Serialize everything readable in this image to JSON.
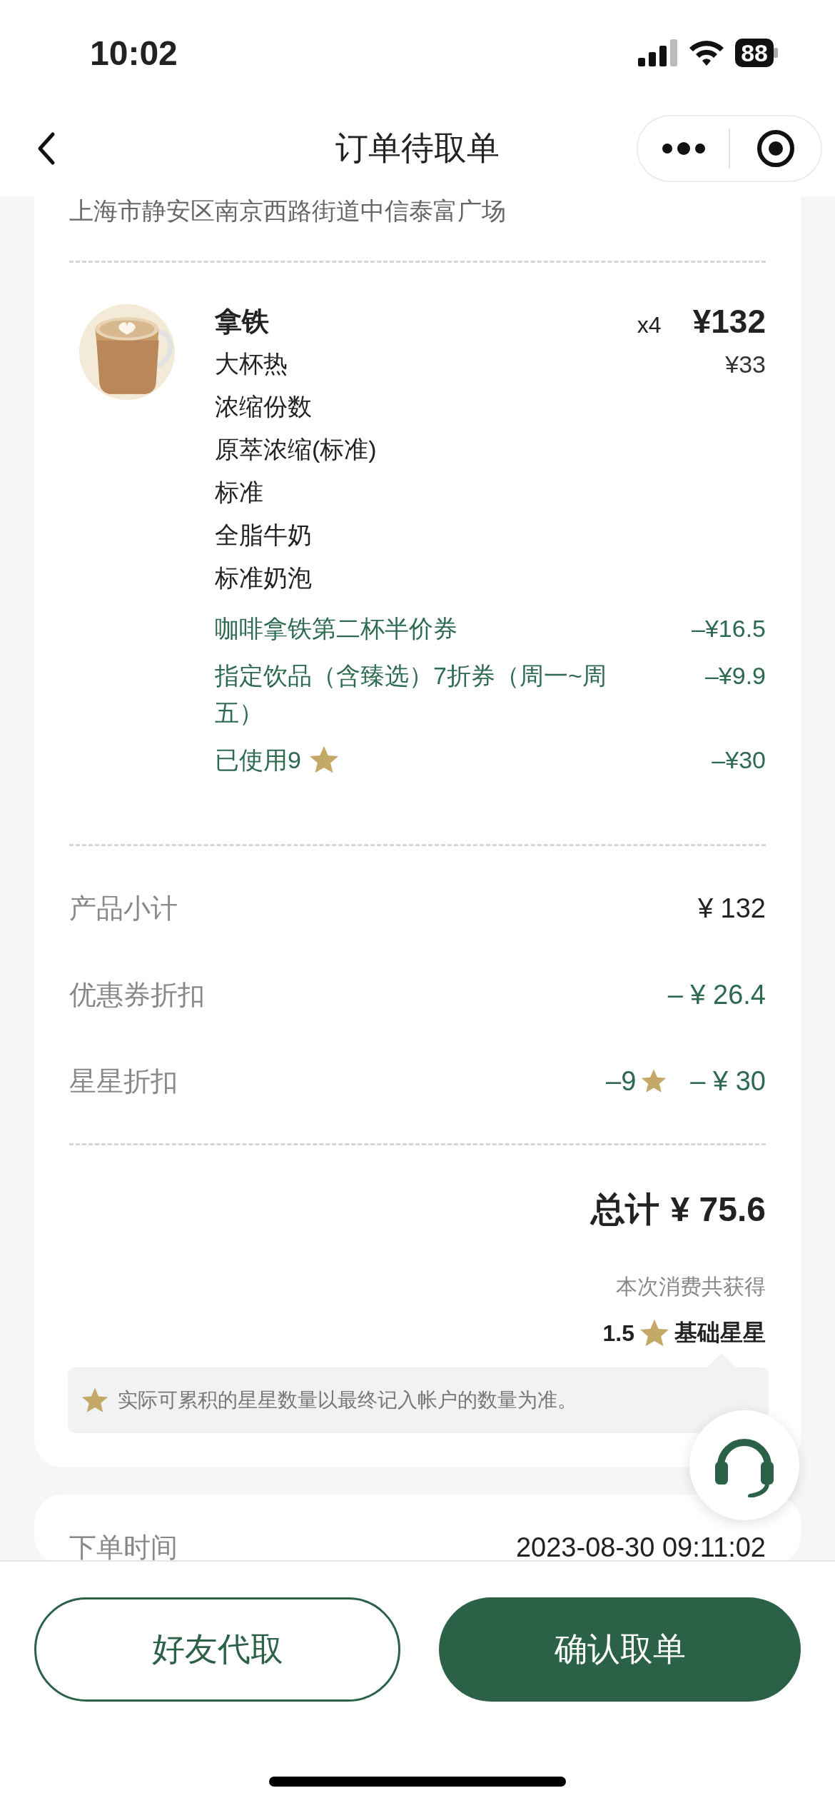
{
  "status_bar": {
    "time": "10:02",
    "battery": "88"
  },
  "nav": {
    "title": "订单待取单"
  },
  "store": {
    "address": "上海市静安区南京西路街道中信泰富广场"
  },
  "items": [
    {
      "name": "拿铁",
      "quantity": "x4",
      "price": "¥132",
      "unit_price": "¥33",
      "options": [
        "大杯热",
        "浓缩份数",
        "原萃浓缩(标准)",
        "标准",
        "全脂牛奶",
        "标准奶泡"
      ],
      "discounts": [
        {
          "kind": "coupon",
          "label": "咖啡拿铁第二杯半价券",
          "amount": "–¥16.5"
        },
        {
          "kind": "coupon",
          "label": "指定饮品（含臻选）7折券（周一~周五）",
          "amount": "–¥9.9"
        },
        {
          "kind": "stars",
          "label": "已使用9",
          "amount": "–¥30"
        }
      ]
    }
  ],
  "summary": [
    {
      "kind": "plain",
      "label": "产品小计",
      "value": "¥ 132"
    },
    {
      "kind": "discount",
      "label": "优惠券折扣",
      "value": "– ¥ 26.4"
    },
    {
      "kind": "stars",
      "label": "星星折扣",
      "stars_used": "–9",
      "value": "– ¥ 30"
    }
  ],
  "total": {
    "label": "总计",
    "amount": "¥ 75.6"
  },
  "earned": {
    "caption": "本次消费共获得",
    "count": "1.5",
    "label": "基础星星"
  },
  "note": "实际可累积的星星数量以最终记入帐户的数量为准。",
  "order_info": [
    {
      "label": "下单时间",
      "value": "2023-08-30 09:11:02"
    }
  ],
  "actions": [
    {
      "kind": "secondary",
      "label": "好友代取"
    },
    {
      "kind": "primary",
      "label": "确认取单"
    }
  ]
}
